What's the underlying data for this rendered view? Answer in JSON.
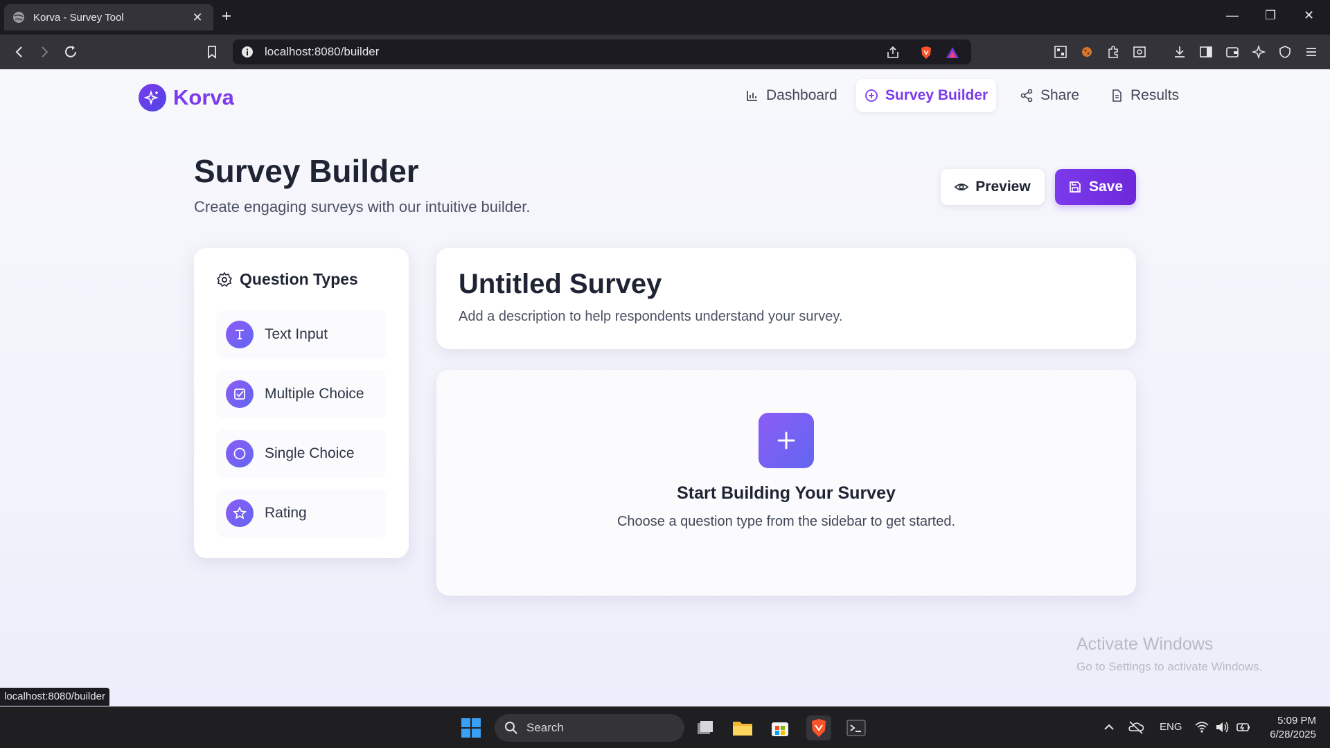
{
  "browser": {
    "tab_title": "Korva - Survey Tool",
    "tab_close": "✕",
    "new_tab": "+",
    "url": "localhost:8080/builder",
    "status_url": "localhost:8080/builder",
    "window_controls": [
      "—",
      "❐",
      "✕"
    ]
  },
  "app": {
    "brand": "Korva",
    "accent_color": "#7c3aed",
    "nav": [
      {
        "label": "Dashboard",
        "icon": "bar-chart-icon"
      },
      {
        "label": "Survey Builder",
        "icon": "plus-circle-icon",
        "active": true
      },
      {
        "label": "Share",
        "icon": "share-icon"
      },
      {
        "label": "Results",
        "icon": "file-text-icon"
      }
    ]
  },
  "header": {
    "title": "Survey Builder",
    "subtitle": "Create engaging surveys with our intuitive builder.",
    "preview_label": "Preview",
    "save_label": "Save"
  },
  "sidebar": {
    "title": "Question Types",
    "items": [
      {
        "label": "Text Input",
        "icon": "type-icon"
      },
      {
        "label": "Multiple Choice",
        "icon": "checkbox-icon"
      },
      {
        "label": "Single Choice",
        "icon": "radio-icon"
      },
      {
        "label": "Rating",
        "icon": "star-icon"
      }
    ]
  },
  "survey": {
    "title": "Untitled Survey",
    "description": "Add a description to help respondents understand your survey."
  },
  "empty_state": {
    "title": "Start Building Your Survey",
    "subtitle": "Choose a question type from the sidebar to get started."
  },
  "watermark": {
    "line1": "Activate Windows",
    "line2": "Go to Settings to activate Windows."
  },
  "taskbar": {
    "search_placeholder": "Search",
    "language": "ENG",
    "time": "5:09 PM",
    "date": "6/28/2025"
  }
}
